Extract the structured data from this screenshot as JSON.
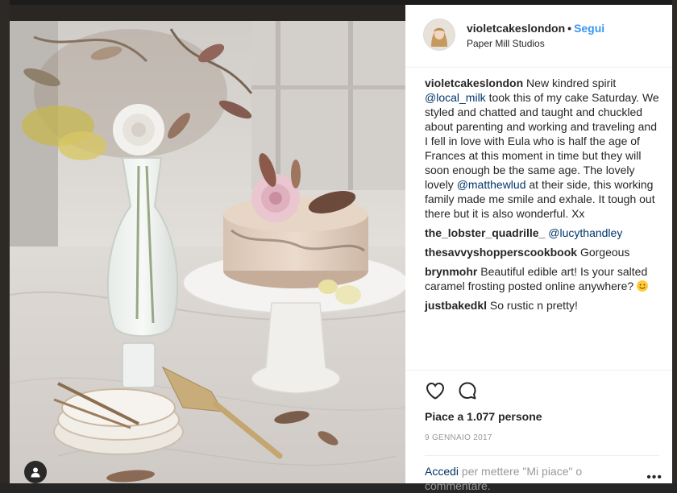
{
  "header": {
    "username": "violetcakeslondon",
    "separator": "•",
    "follow_label": "Segui",
    "location": "Paper Mill Studios"
  },
  "caption": {
    "username": "violetcakeslondon",
    "text_1": "New kindred spirit",
    "mention_1": "@local_milk",
    "text_2": "took this of my cake Saturday. We styled and chatted and taught and chuckled about parenting and working and traveling and I fell in love with Eula who is half the age of Frances at this moment in time but they will soon enough be the same age. The lovely lovely",
    "mention_2": "@matthewlud",
    "text_3": "at their side, this working family made me smile and exhale. It tough out there but it is also wonderful. Xx"
  },
  "comments": [
    {
      "username": "the_lobster_quadrille_",
      "mention": "@lucythandley",
      "text": ""
    },
    {
      "username": "thesavvyshopperscookbook",
      "mention": "",
      "text": "Gorgeous"
    },
    {
      "username": "brynmohr",
      "mention": "",
      "text": "Beautiful edible art! Is your salted caramel frosting posted online anywhere?"
    },
    {
      "username": "justbakedkl",
      "mention": "",
      "text": "So rustic n pretty!"
    }
  ],
  "likes": "Piace a 1.077 persone",
  "date": "9 GENNAIO 2017",
  "login_prompt": {
    "link": "Accedi",
    "text": "per mettere \"Mi piace\" o commentare."
  },
  "more_label": "•••",
  "icons": {
    "like": "heart-outline-icon",
    "comment": "speech-bubble-icon",
    "tag": "person-tag-icon",
    "emoji": "smiling-face-emoji"
  },
  "colors": {
    "link": "#003569",
    "follow": "#3897f0",
    "muted": "#999999",
    "text": "#262626"
  }
}
